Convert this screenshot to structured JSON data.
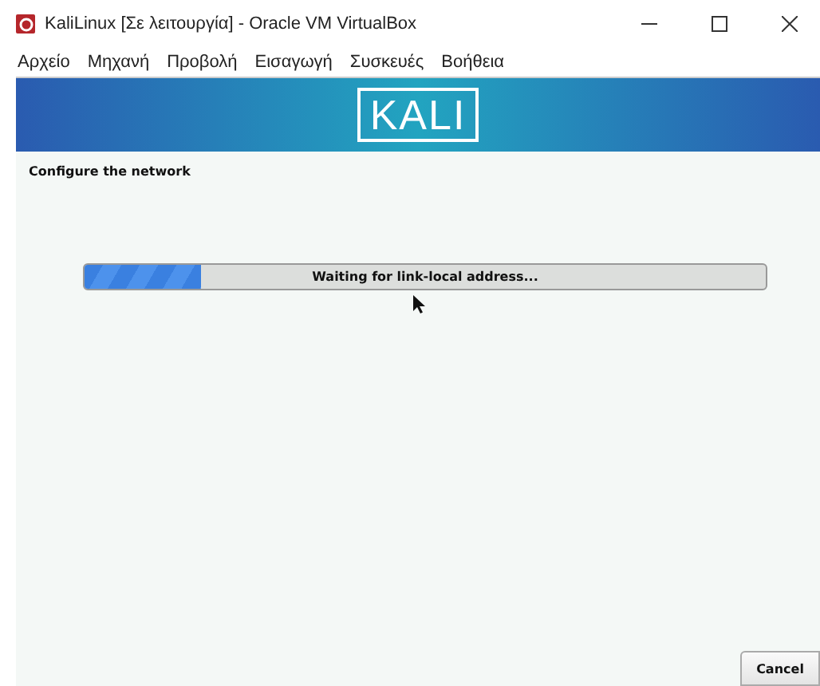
{
  "window": {
    "title": "KaliLinux [Σε λειτουργία] - Oracle VM VirtualBox"
  },
  "menu": [
    "Αρχείο",
    "Μηχανή",
    "Προβολή",
    "Εισαγωγή",
    "Συσκευές",
    "Βοήθεια"
  ],
  "banner": {
    "logo": "KALI"
  },
  "installer": {
    "heading": "Configure the network",
    "progress": {
      "level": 0.17,
      "label": "Waiting for link-local address..."
    },
    "buttons": [
      "Cancel"
    ]
  }
}
